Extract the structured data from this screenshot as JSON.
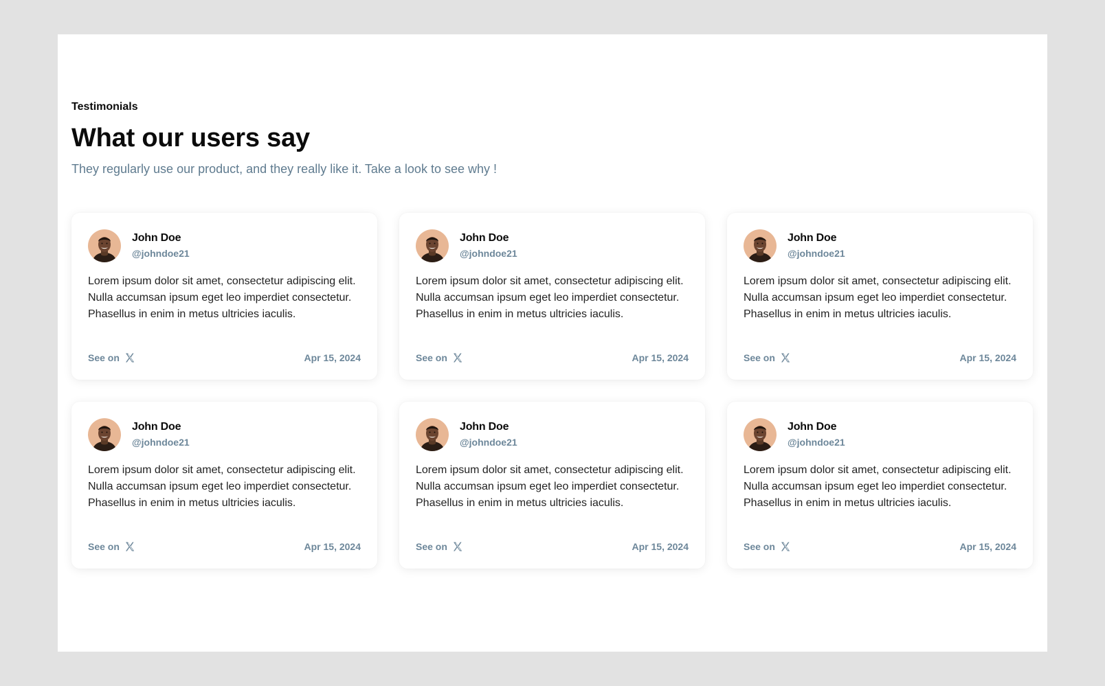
{
  "section": {
    "eyebrow": "Testimonials",
    "title": "What our users say",
    "subtitle": "They regularly use our product, and they really like it. Take a look to see why !"
  },
  "colors": {
    "page_bg": "#e2e2e2",
    "card_bg": "#ffffff",
    "muted_text": "#6d879a",
    "subtitle_text": "#5f7b8f",
    "avatar_bg": "#e8b795"
  },
  "testimonials": [
    {
      "name": "John Doe",
      "handle": "@johndoe21",
      "quote": "Lorem ipsum dolor sit amet, consectetur adipiscing elit. Nulla accumsan ipsum eget leo imperdiet consectetur. Phasellus in enim in metus ultricies iaculis.",
      "see_on_label": "See on",
      "platform_icon": "x-logo-icon",
      "date": "Apr 15, 2024"
    },
    {
      "name": "John Doe",
      "handle": "@johndoe21",
      "quote": "Lorem ipsum dolor sit amet, consectetur adipiscing elit. Nulla accumsan ipsum eget leo imperdiet consectetur. Phasellus in enim in metus ultricies iaculis.",
      "see_on_label": "See on",
      "platform_icon": "x-logo-icon",
      "date": "Apr 15, 2024"
    },
    {
      "name": "John Doe",
      "handle": "@johndoe21",
      "quote": "Lorem ipsum dolor sit amet, consectetur adipiscing elit. Nulla accumsan ipsum eget leo imperdiet consectetur. Phasellus in enim in metus ultricies iaculis.",
      "see_on_label": "See on",
      "platform_icon": "x-logo-icon",
      "date": "Apr 15, 2024"
    },
    {
      "name": "John Doe",
      "handle": "@johndoe21",
      "quote": "Lorem ipsum dolor sit amet, consectetur adipiscing elit. Nulla accumsan ipsum eget leo imperdiet consectetur. Phasellus in enim in metus ultricies iaculis.",
      "see_on_label": "See on",
      "platform_icon": "x-logo-icon",
      "date": "Apr 15, 2024"
    },
    {
      "name": "John Doe",
      "handle": "@johndoe21",
      "quote": "Lorem ipsum dolor sit amet, consectetur adipiscing elit. Nulla accumsan ipsum eget leo imperdiet consectetur. Phasellus in enim in metus ultricies iaculis.",
      "see_on_label": "See on",
      "platform_icon": "x-logo-icon",
      "date": "Apr 15, 2024"
    },
    {
      "name": "John Doe",
      "handle": "@johndoe21",
      "quote": "Lorem ipsum dolor sit amet, consectetur adipiscing elit. Nulla accumsan ipsum eget leo imperdiet consectetur. Phasellus in enim in metus ultricies iaculis.",
      "see_on_label": "See on",
      "platform_icon": "x-logo-icon",
      "date": "Apr 15, 2024"
    }
  ]
}
